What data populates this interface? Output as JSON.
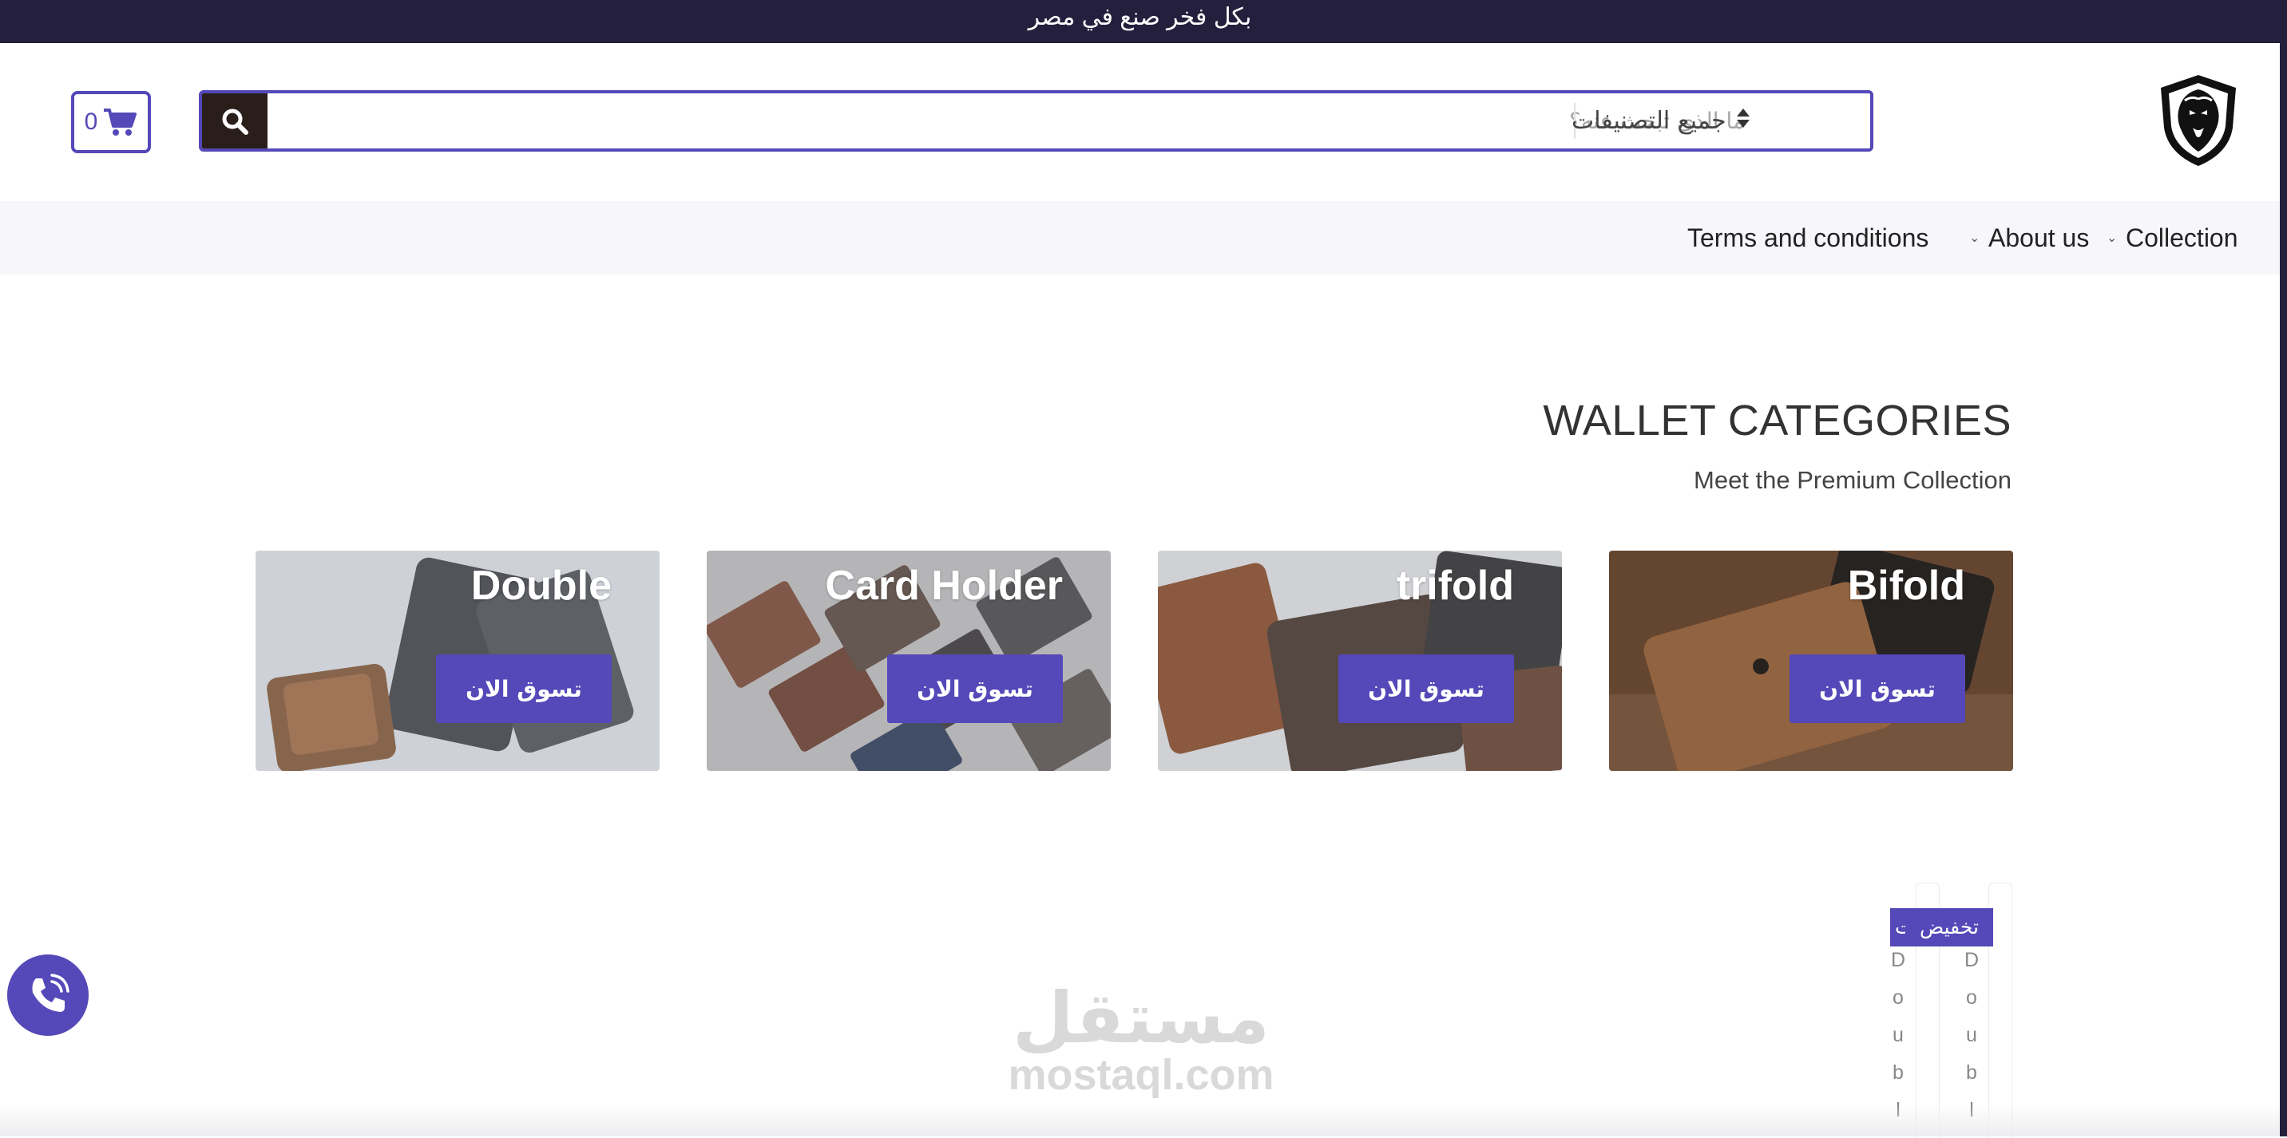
{
  "top_bar": {
    "text": "بكل فخر صنع في مصر"
  },
  "header": {
    "logo_icon": "lion-shield-icon",
    "search": {
      "placeholder": "ما الذي تبحث عنه؟",
      "value": "",
      "category_label": "جميع التصنيفات",
      "button_icon": "search-icon"
    },
    "cart": {
      "count": "0",
      "icon": "cart-icon"
    }
  },
  "nav": {
    "items": [
      {
        "label": "Collection",
        "has_dropdown": true
      },
      {
        "label": "About us",
        "has_dropdown": true
      },
      {
        "label": "Terms and conditions",
        "has_dropdown": false
      }
    ]
  },
  "section": {
    "title": "WALLET CATEGORIES",
    "subtitle": "Meet the Premium Collection"
  },
  "categories": [
    {
      "title": "Double",
      "button": "تسوق الان"
    },
    {
      "title": "Card Holder",
      "button": "تسوق الان"
    },
    {
      "title": "trifold",
      "button": "تسوق الان"
    },
    {
      "title": "Bifold",
      "button": "تسوق الان"
    }
  ],
  "products": {
    "sale_badge": "تخفيض",
    "sale_badge_partial": "ت",
    "name_letters": [
      "D",
      "o",
      "u",
      "b",
      "l"
    ]
  },
  "floating": {
    "phone_icon": "phone-icon"
  },
  "watermark": {
    "arabic": "مستقل",
    "latin": "mostaql.com"
  },
  "colors": {
    "accent": "#5548b8",
    "top_bar": "#231f3d",
    "search_button": "#2a1e1a",
    "nav_bg": "#f7f6fb"
  }
}
